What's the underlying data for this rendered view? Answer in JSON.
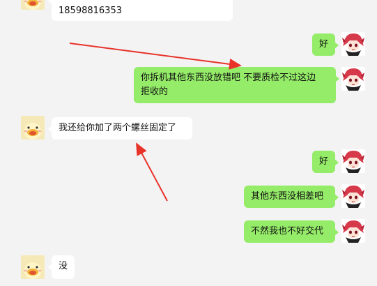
{
  "messages": [
    {
      "side": "in",
      "text_partial": "",
      "text": "18598816353"
    },
    {
      "side": "out",
      "text": "好"
    },
    {
      "side": "out",
      "text": "你拆机其他东西没放错吧 不要质检不过这边",
      "text2": "拒收的"
    },
    {
      "side": "in",
      "text": "我还给你加了两个螺丝固定了"
    },
    {
      "side": "out",
      "text": "好"
    },
    {
      "side": "out",
      "text": "其他东西没相差吧"
    },
    {
      "side": "out",
      "text": "不然我也不好交代"
    },
    {
      "side": "in",
      "text": "没"
    }
  ],
  "colors": {
    "background": "#f3f3f3",
    "outgoing_bubble": "#95ec69",
    "incoming_bubble": "#ffffff",
    "annotation_arrow": "#e8322a"
  },
  "icons": {
    "incoming_avatar": "cartoon-chick-avatar",
    "outgoing_avatar": "anime-red-hair-avatar"
  }
}
